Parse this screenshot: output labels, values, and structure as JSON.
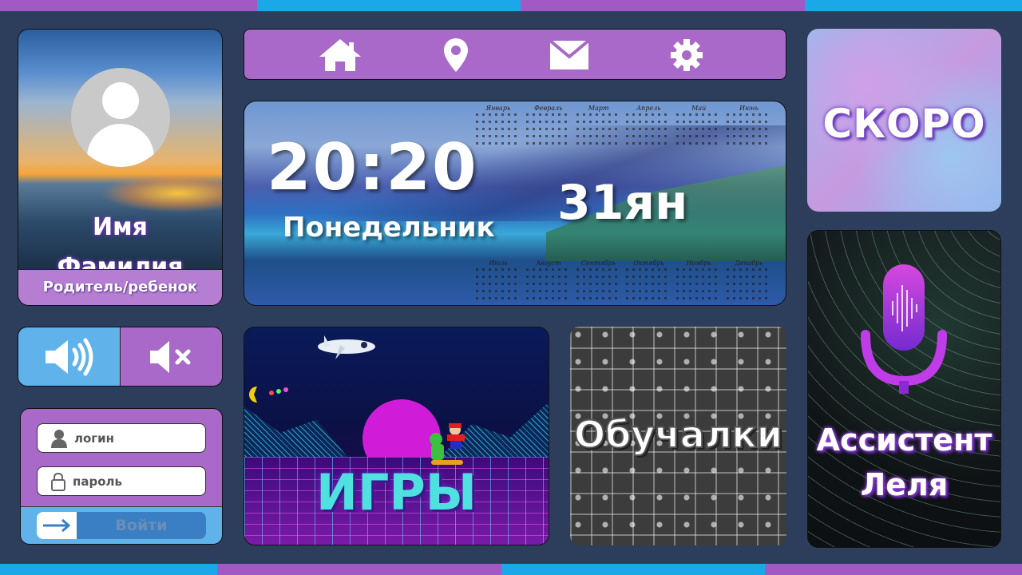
{
  "colors": {
    "background": "#2c3e5c",
    "purple": "#a869c9",
    "blue": "#5fb3ea",
    "stripe_blue": "#1aa8e8",
    "stripe_purple": "#a259c4"
  },
  "nav": {
    "icons": [
      "home-icon",
      "location-pin-icon",
      "mail-icon",
      "gear-icon"
    ]
  },
  "profile": {
    "first_name": "Имя",
    "last_name": "Фамилия",
    "role": "Родитель/ребенок"
  },
  "clock": {
    "time": "20:20",
    "weekday": "Понедельник",
    "date": "31ян",
    "calendar_months_top": [
      "Январь",
      "Февраль",
      "Март",
      "Апрель",
      "Май",
      "Июнь"
    ],
    "calendar_months_bottom": [
      "Июль",
      "Август",
      "Сентябрь",
      "Октябрь",
      "Ноябрь",
      "Декабрь"
    ]
  },
  "soon": {
    "label": "СКОРО"
  },
  "volume": {
    "on_icon": "speaker-on-icon",
    "off_icon": "speaker-mute-icon"
  },
  "login": {
    "login_placeholder": "логин",
    "password_placeholder": "пароль",
    "submit_label": "Войти"
  },
  "tiles": {
    "games": "ИГРЫ",
    "learning": "Обучалки",
    "assistant_line1": "Ассистент",
    "assistant_line2": "Леля"
  }
}
